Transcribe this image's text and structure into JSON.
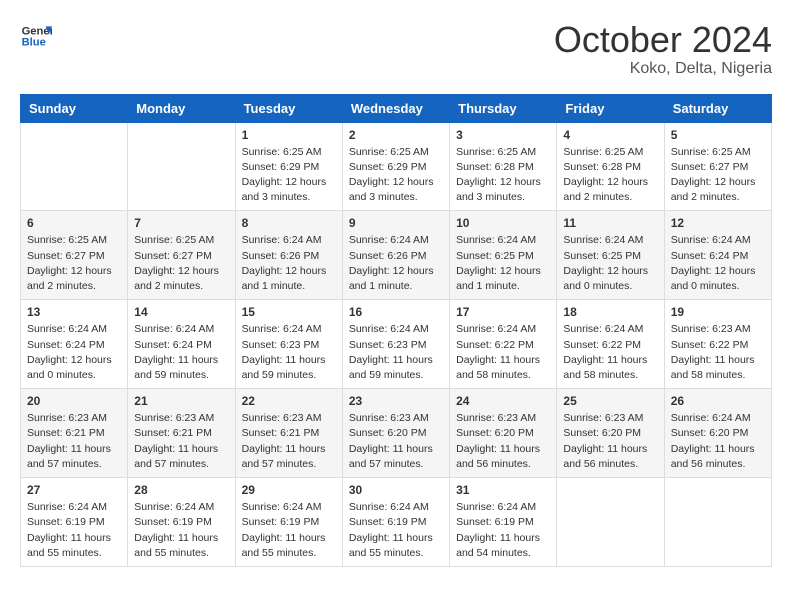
{
  "header": {
    "logo_line1": "General",
    "logo_line2": "Blue",
    "title": "October 2024",
    "subtitle": "Koko, Delta, Nigeria"
  },
  "calendar": {
    "days_of_week": [
      "Sunday",
      "Monday",
      "Tuesday",
      "Wednesday",
      "Thursday",
      "Friday",
      "Saturday"
    ],
    "weeks": [
      [
        {
          "day": "",
          "info": ""
        },
        {
          "day": "",
          "info": ""
        },
        {
          "day": "1",
          "info": "Sunrise: 6:25 AM\nSunset: 6:29 PM\nDaylight: 12 hours and 3 minutes."
        },
        {
          "day": "2",
          "info": "Sunrise: 6:25 AM\nSunset: 6:29 PM\nDaylight: 12 hours and 3 minutes."
        },
        {
          "day": "3",
          "info": "Sunrise: 6:25 AM\nSunset: 6:28 PM\nDaylight: 12 hours and 3 minutes."
        },
        {
          "day": "4",
          "info": "Sunrise: 6:25 AM\nSunset: 6:28 PM\nDaylight: 12 hours and 2 minutes."
        },
        {
          "day": "5",
          "info": "Sunrise: 6:25 AM\nSunset: 6:27 PM\nDaylight: 12 hours and 2 minutes."
        }
      ],
      [
        {
          "day": "6",
          "info": "Sunrise: 6:25 AM\nSunset: 6:27 PM\nDaylight: 12 hours and 2 minutes."
        },
        {
          "day": "7",
          "info": "Sunrise: 6:25 AM\nSunset: 6:27 PM\nDaylight: 12 hours and 2 minutes."
        },
        {
          "day": "8",
          "info": "Sunrise: 6:24 AM\nSunset: 6:26 PM\nDaylight: 12 hours and 1 minute."
        },
        {
          "day": "9",
          "info": "Sunrise: 6:24 AM\nSunset: 6:26 PM\nDaylight: 12 hours and 1 minute."
        },
        {
          "day": "10",
          "info": "Sunrise: 6:24 AM\nSunset: 6:25 PM\nDaylight: 12 hours and 1 minute."
        },
        {
          "day": "11",
          "info": "Sunrise: 6:24 AM\nSunset: 6:25 PM\nDaylight: 12 hours and 0 minutes."
        },
        {
          "day": "12",
          "info": "Sunrise: 6:24 AM\nSunset: 6:24 PM\nDaylight: 12 hours and 0 minutes."
        }
      ],
      [
        {
          "day": "13",
          "info": "Sunrise: 6:24 AM\nSunset: 6:24 PM\nDaylight: 12 hours and 0 minutes."
        },
        {
          "day": "14",
          "info": "Sunrise: 6:24 AM\nSunset: 6:24 PM\nDaylight: 11 hours and 59 minutes."
        },
        {
          "day": "15",
          "info": "Sunrise: 6:24 AM\nSunset: 6:23 PM\nDaylight: 11 hours and 59 minutes."
        },
        {
          "day": "16",
          "info": "Sunrise: 6:24 AM\nSunset: 6:23 PM\nDaylight: 11 hours and 59 minutes."
        },
        {
          "day": "17",
          "info": "Sunrise: 6:24 AM\nSunset: 6:22 PM\nDaylight: 11 hours and 58 minutes."
        },
        {
          "day": "18",
          "info": "Sunrise: 6:24 AM\nSunset: 6:22 PM\nDaylight: 11 hours and 58 minutes."
        },
        {
          "day": "19",
          "info": "Sunrise: 6:23 AM\nSunset: 6:22 PM\nDaylight: 11 hours and 58 minutes."
        }
      ],
      [
        {
          "day": "20",
          "info": "Sunrise: 6:23 AM\nSunset: 6:21 PM\nDaylight: 11 hours and 57 minutes."
        },
        {
          "day": "21",
          "info": "Sunrise: 6:23 AM\nSunset: 6:21 PM\nDaylight: 11 hours and 57 minutes."
        },
        {
          "day": "22",
          "info": "Sunrise: 6:23 AM\nSunset: 6:21 PM\nDaylight: 11 hours and 57 minutes."
        },
        {
          "day": "23",
          "info": "Sunrise: 6:23 AM\nSunset: 6:20 PM\nDaylight: 11 hours and 57 minutes."
        },
        {
          "day": "24",
          "info": "Sunrise: 6:23 AM\nSunset: 6:20 PM\nDaylight: 11 hours and 56 minutes."
        },
        {
          "day": "25",
          "info": "Sunrise: 6:23 AM\nSunset: 6:20 PM\nDaylight: 11 hours and 56 minutes."
        },
        {
          "day": "26",
          "info": "Sunrise: 6:24 AM\nSunset: 6:20 PM\nDaylight: 11 hours and 56 minutes."
        }
      ],
      [
        {
          "day": "27",
          "info": "Sunrise: 6:24 AM\nSunset: 6:19 PM\nDaylight: 11 hours and 55 minutes."
        },
        {
          "day": "28",
          "info": "Sunrise: 6:24 AM\nSunset: 6:19 PM\nDaylight: 11 hours and 55 minutes."
        },
        {
          "day": "29",
          "info": "Sunrise: 6:24 AM\nSunset: 6:19 PM\nDaylight: 11 hours and 55 minutes."
        },
        {
          "day": "30",
          "info": "Sunrise: 6:24 AM\nSunset: 6:19 PM\nDaylight: 11 hours and 55 minutes."
        },
        {
          "day": "31",
          "info": "Sunrise: 6:24 AM\nSunset: 6:19 PM\nDaylight: 11 hours and 54 minutes."
        },
        {
          "day": "",
          "info": ""
        },
        {
          "day": "",
          "info": ""
        }
      ]
    ]
  }
}
